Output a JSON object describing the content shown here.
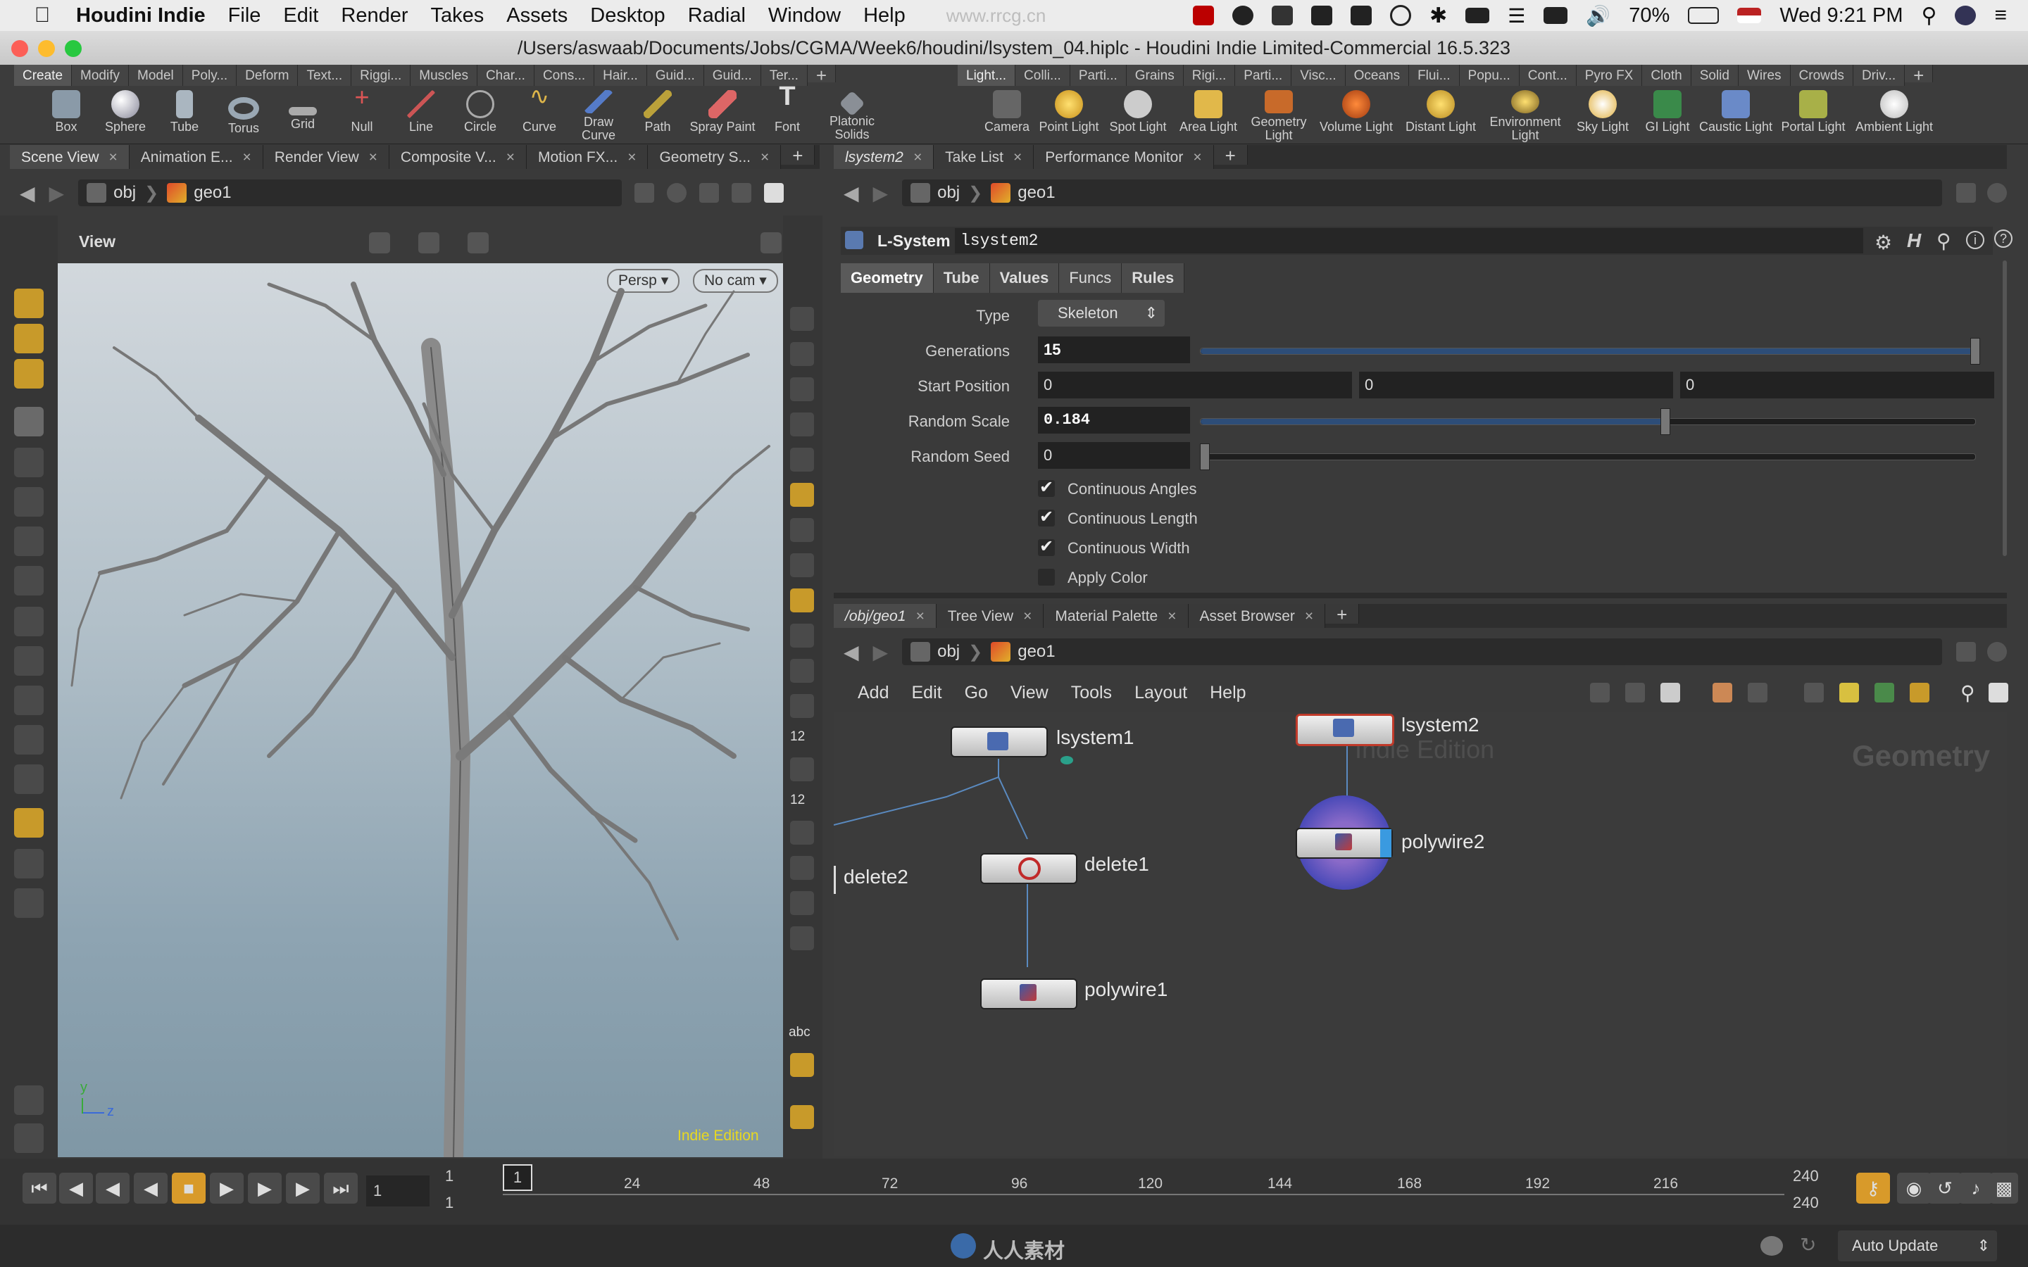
{
  "menubar": {
    "apple": "",
    "app": "Houdini Indie",
    "items": [
      "File",
      "Edit",
      "Render",
      "Takes",
      "Assets",
      "Desktop",
      "Radial",
      "Window",
      "Help"
    ],
    "watermark": "www.rrcg.cn",
    "battery": "70%",
    "clock": "Wed 9:21 PM"
  },
  "window": {
    "title": "/Users/aswaab/Documents/Jobs/CGMA/Week6/houdini/lsystem_04.hiplc - Houdini Indie Limited-Commercial 16.5.323"
  },
  "shelf_left": {
    "tabs": [
      "Create",
      "Modify",
      "Model",
      "Poly...",
      "Deform",
      "Text...",
      "Riggi...",
      "Muscles",
      "Char...",
      "Cons...",
      "Hair...",
      "Guid...",
      "Guid...",
      "Ter..."
    ],
    "tools": [
      "Box",
      "Sphere",
      "Tube",
      "Torus",
      "Grid",
      "Null",
      "Line",
      "Circle",
      "Curve",
      "Draw Curve",
      "Path",
      "Spray Paint",
      "Font",
      "Platonic Solids"
    ]
  },
  "shelf_right": {
    "tabs": [
      "Light...",
      "Colli...",
      "Parti...",
      "Grains",
      "Rigi...",
      "Parti...",
      "Visc...",
      "Oceans",
      "Flui...",
      "Popu...",
      "Cont...",
      "Pyro FX",
      "Cloth",
      "Solid",
      "Wires",
      "Crowds",
      "Driv..."
    ],
    "tools": [
      "Camera",
      "Point Light",
      "Spot Light",
      "Area Light",
      "Geometry Light",
      "Volume Light",
      "Distant Light",
      "Environment Light",
      "Sky Light",
      "GI Light",
      "Caustic Light",
      "Portal Light",
      "Ambient Light"
    ]
  },
  "left_pane": {
    "tabs": [
      "Scene View",
      "Animation E...",
      "Render View",
      "Composite V...",
      "Motion FX...",
      "Geometry S..."
    ],
    "path": [
      "obj",
      "geo1"
    ],
    "view_label": "View",
    "persp": "Persp",
    "cam": "No cam",
    "edition": "Indie Edition",
    "axis_y": "y",
    "axis_z": "z",
    "rightbar_labels": [
      "12",
      "12",
      "abc"
    ]
  },
  "param_pane": {
    "tabs": [
      "lsystem2",
      "Take List",
      "Performance Monitor"
    ],
    "path": [
      "obj",
      "geo1"
    ],
    "node_type": "L-System",
    "node_name": "lsystem2",
    "subtabs": [
      "Geometry",
      "Tube",
      "Values",
      "Funcs",
      "Rules"
    ],
    "type_label": "Type",
    "type_value": "Skeleton",
    "generations_label": "Generations",
    "generations": "15",
    "generations_frac": 1.0,
    "start_label": "Start Position",
    "start": [
      "0",
      "0",
      "0"
    ],
    "rscale_label": "Random Scale",
    "rscale": "0.184",
    "rscale_frac": 0.6,
    "rseed_label": "Random Seed",
    "rseed": "0",
    "rseed_frac": 0.0,
    "checks": [
      {
        "label": "Continuous Angles",
        "on": true
      },
      {
        "label": "Continuous Length",
        "on": true
      },
      {
        "label": "Continuous Width",
        "on": true
      },
      {
        "label": "Apply Color",
        "on": false
      }
    ]
  },
  "network_pane": {
    "tabs": [
      "/obj/geo1",
      "Tree View",
      "Material Palette",
      "Asset Browser"
    ],
    "path": [
      "obj",
      "geo1"
    ],
    "menu": [
      "Add",
      "Edit",
      "Go",
      "View",
      "Tools",
      "Layout",
      "Help"
    ],
    "context": "Geometry",
    "edition": "Indie Edition",
    "nodes": {
      "lsystem1": "lsystem1",
      "lsystem2": "lsystem2",
      "delete1": "delete1",
      "delete2": "delete2",
      "polywire1": "polywire1",
      "polywire2": "polywire2"
    }
  },
  "timeline": {
    "current": "1",
    "start1": "1",
    "start2": "1",
    "marker": "1",
    "ticks": [
      "24",
      "48",
      "72",
      "96",
      "120",
      "144",
      "168",
      "192",
      "216"
    ],
    "end1": "240",
    "end2": "240"
  },
  "statusbar": {
    "logo": "人人素材",
    "auto_update": "Auto Update"
  }
}
